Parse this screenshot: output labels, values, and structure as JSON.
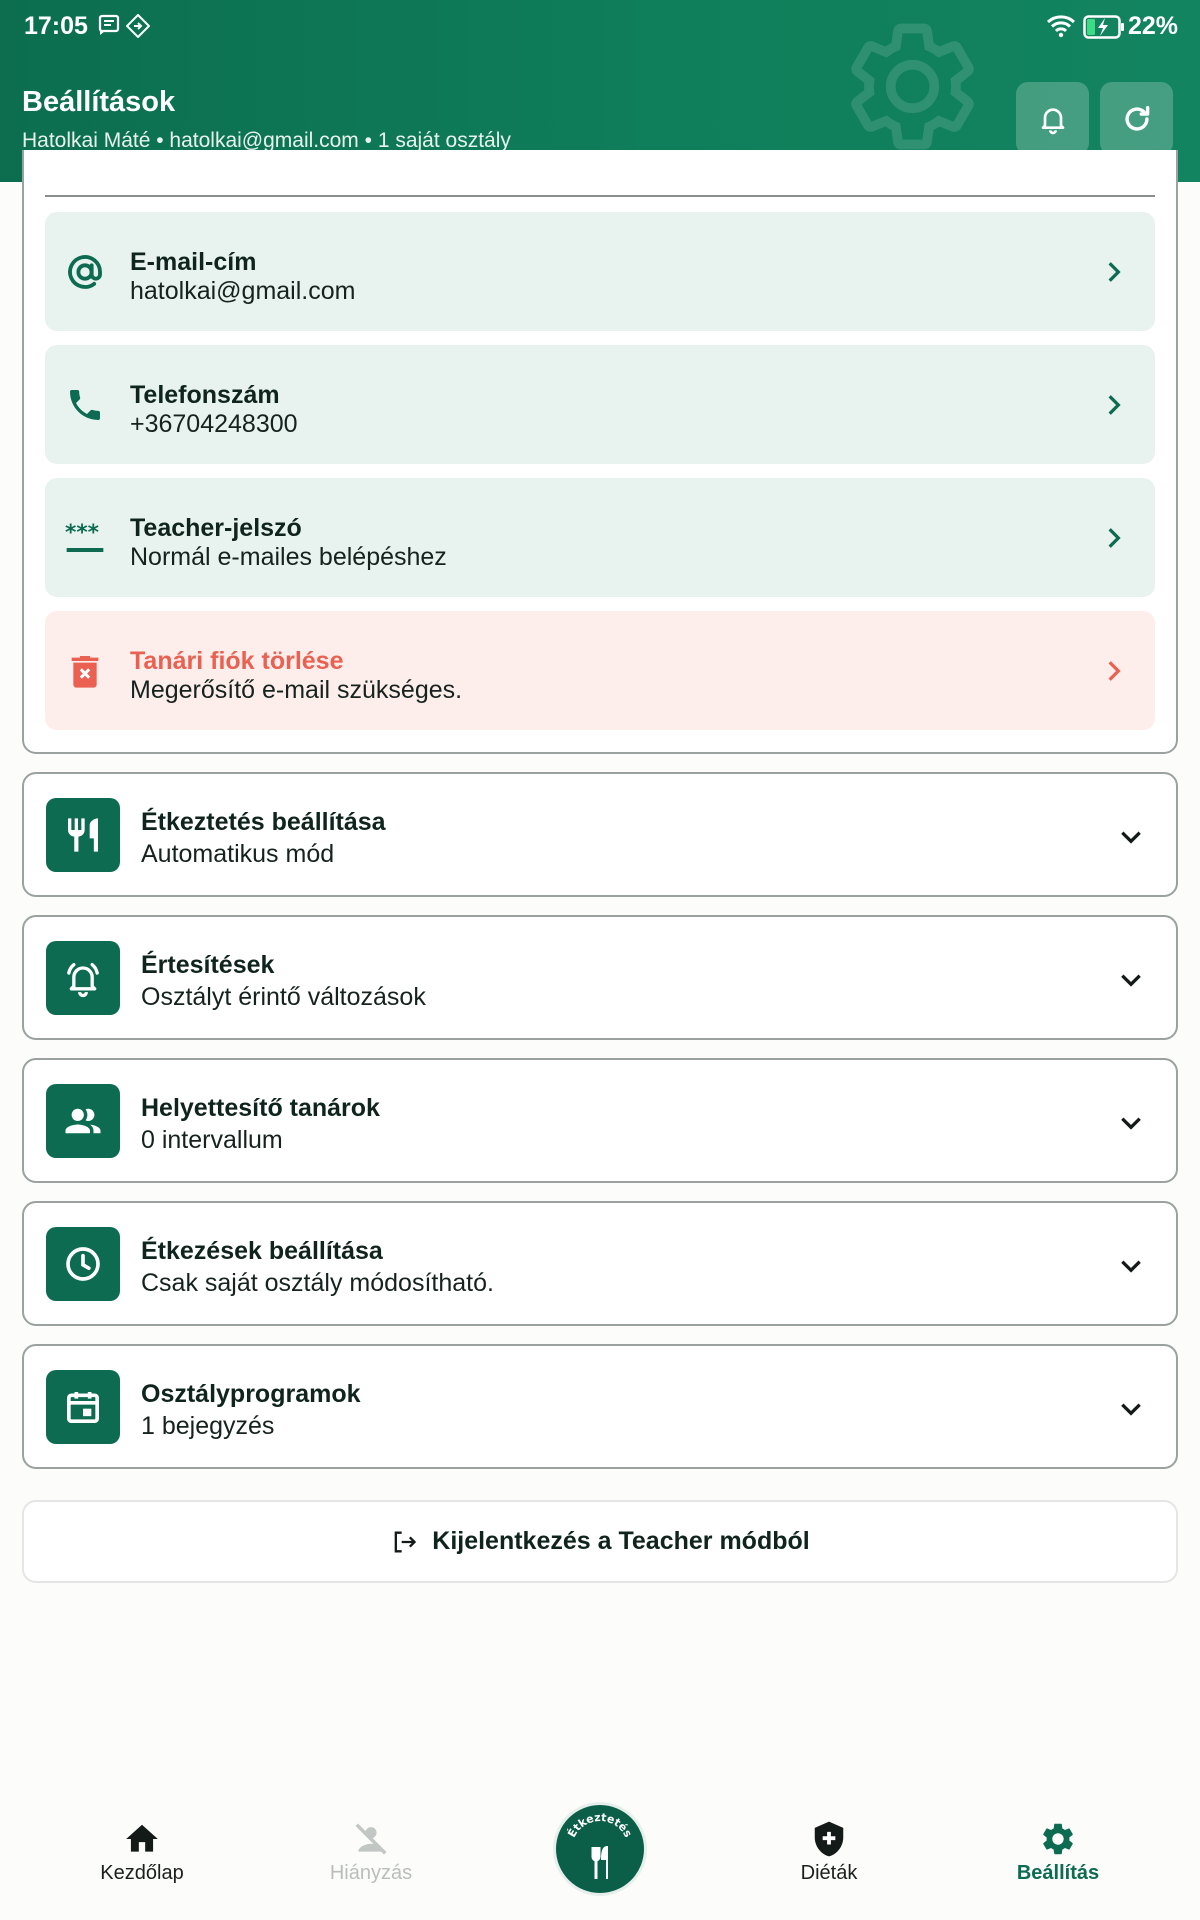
{
  "status_bar": {
    "time": "17:05",
    "battery": "22%",
    "icons": [
      "message-icon",
      "vpn-diamond-icon",
      "wifi-icon",
      "battery-charging-icon"
    ]
  },
  "header": {
    "title": "Beállítások",
    "subtitle": "Hatolkai Máté • hatolkai@gmail.com • 1 saját osztály",
    "buttons": [
      "bell-icon",
      "refresh-icon"
    ],
    "background_icon": "gear-icon",
    "color": "#0f7e5a"
  },
  "account": {
    "rows": [
      {
        "icon": "at-icon",
        "title": "E-mail-cím",
        "subtitle": "hatolkai@gmail.com"
      },
      {
        "icon": "phone-icon",
        "title": "Telefonszám",
        "subtitle": "+36704248300"
      },
      {
        "icon": "password-icon",
        "title": "Teacher-jelszó",
        "subtitle": "Normál e-mailes belépéshez"
      },
      {
        "icon": "trash-icon",
        "title": "Tanári fiók törlése",
        "subtitle": "Megerősítő e-mail szükséges.",
        "danger": true
      }
    ]
  },
  "sections": [
    {
      "icon": "fork-knife-icon",
      "title": "Étkeztetés beállítása",
      "subtitle": "Automatikus mód"
    },
    {
      "icon": "alarm-bell-icon",
      "title": "Értesítések",
      "subtitle": "Osztályt érintő változások"
    },
    {
      "icon": "people-icon",
      "title": "Helyettesítő tanárok",
      "subtitle": "0 intervallum"
    },
    {
      "icon": "clock-icon",
      "title": "Étkezések beállítása",
      "subtitle": "Csak saját osztály módosítható."
    },
    {
      "icon": "calendar-icon",
      "title": "Osztályprogramok",
      "subtitle": "1 bejegyzés"
    }
  ],
  "logout": {
    "label": "Kijelentkezés a Teacher módból",
    "icon": "logout-icon"
  },
  "nav": {
    "items": [
      {
        "label": "Kezdőlap",
        "icon": "home-icon"
      },
      {
        "label": "Hiányzás",
        "icon": "person-off-icon",
        "disabled": true
      },
      {
        "label": "Étkeztetés",
        "icon": "cutlery-icon",
        "center": true
      },
      {
        "label": "Diéták",
        "icon": "shield-plus-icon"
      },
      {
        "label": "Beállítás",
        "icon": "gear-icon",
        "active": true
      }
    ]
  },
  "colors": {
    "accent": "#0c6b50",
    "danger": "#ea6152",
    "row_bg": "#e8f2ef",
    "danger_bg": "#fdeeeb"
  }
}
